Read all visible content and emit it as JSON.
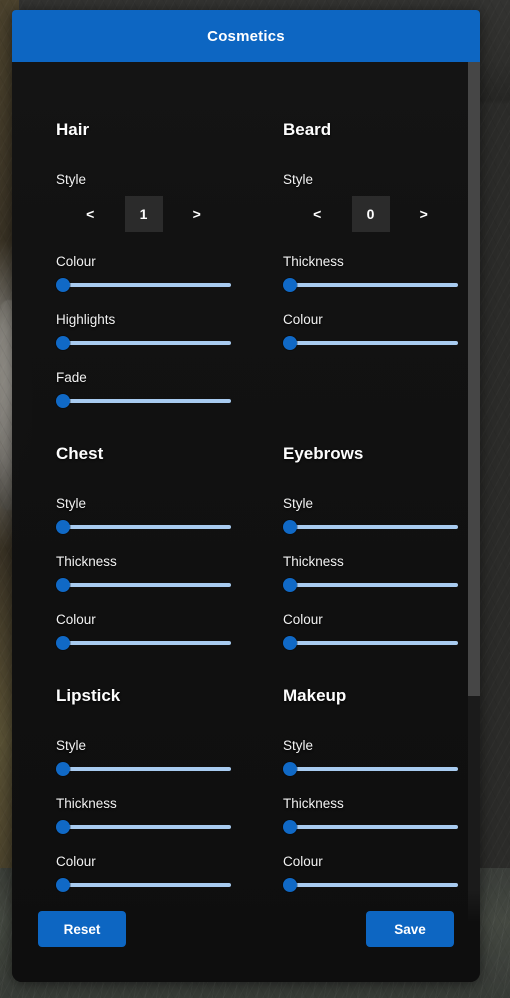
{
  "window": {
    "title": "Cosmetics",
    "accent_color": "#0d66c2",
    "panel_bg": "#121212",
    "slider_track_color": "#a8cbf0",
    "slider_thumb_color": "#1069c6"
  },
  "groups": [
    {
      "title": "Hair",
      "stepper": {
        "label": "Style",
        "prev": "<",
        "next": ">",
        "value": "1"
      },
      "sliders": [
        {
          "label": "Colour",
          "value": 0
        },
        {
          "label": "Highlights",
          "value": 0
        },
        {
          "label": "Fade",
          "value": 0
        }
      ]
    },
    {
      "title": "Beard",
      "stepper": {
        "label": "Style",
        "prev": "<",
        "next": ">",
        "value": "0"
      },
      "sliders": [
        {
          "label": "Thickness",
          "value": 0
        },
        {
          "label": "Colour",
          "value": 0
        }
      ]
    },
    {
      "title": "Chest",
      "sliders": [
        {
          "label": "Style",
          "value": 0
        },
        {
          "label": "Thickness",
          "value": 0
        },
        {
          "label": "Colour",
          "value": 0
        }
      ]
    },
    {
      "title": "Eyebrows",
      "sliders": [
        {
          "label": "Style",
          "value": 0
        },
        {
          "label": "Thickness",
          "value": 0
        },
        {
          "label": "Colour",
          "value": 0
        }
      ]
    },
    {
      "title": "Lipstick",
      "sliders": [
        {
          "label": "Style",
          "value": 0
        },
        {
          "label": "Thickness",
          "value": 0
        },
        {
          "label": "Colour",
          "value": 0
        }
      ]
    },
    {
      "title": "Makeup",
      "sliders": [
        {
          "label": "Style",
          "value": 0
        },
        {
          "label": "Thickness",
          "value": 0
        },
        {
          "label": "Colour",
          "value": 0
        }
      ]
    }
  ],
  "footer": {
    "reset_label": "Reset",
    "save_label": "Save"
  },
  "scrollbar": {
    "thumb_fraction": 0.69,
    "scroll_position": 0
  }
}
